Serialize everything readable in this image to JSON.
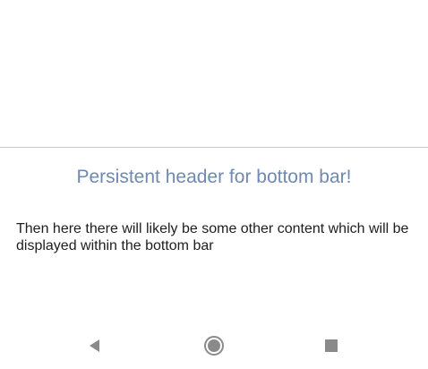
{
  "bottom_sheet": {
    "header": "Persistent header for bottom bar!",
    "body": "Then here there will likely be some other content which will be displayed within the bottom bar"
  },
  "nav_bar": {
    "back_icon": "back-triangle-icon",
    "home_icon": "home-circle-icon",
    "recents_icon": "recents-square-icon"
  },
  "colors": {
    "header_text": "#6f89b3",
    "body_text": "#1e1e1e",
    "nav_icon": "#8a8a8a",
    "divider": "#c8c8c8"
  }
}
